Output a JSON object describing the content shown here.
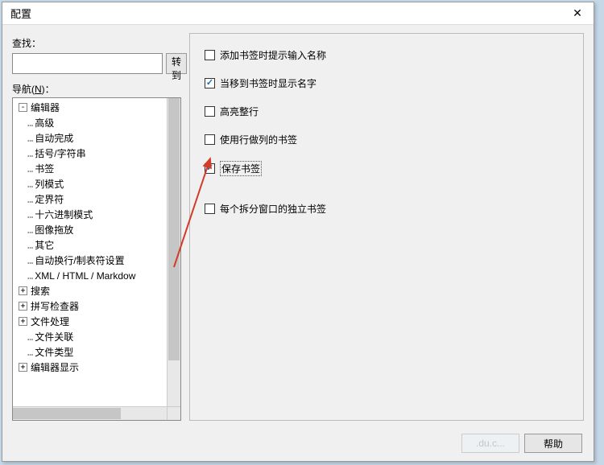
{
  "title": "配置",
  "close_glyph": "✕",
  "left": {
    "search_label": "查找：",
    "goto_btn": "转到",
    "nav_label_prefix": "导航(",
    "nav_label_key": "N",
    "nav_label_suffix": ")："
  },
  "tree": [
    {
      "depth": 0,
      "tog": "-",
      "label": "编辑器"
    },
    {
      "depth": 1,
      "tog": "",
      "label": "高级"
    },
    {
      "depth": 1,
      "tog": "",
      "label": "自动完成"
    },
    {
      "depth": 1,
      "tog": "",
      "label": "括号/字符串"
    },
    {
      "depth": 1,
      "tog": "",
      "label": "书签"
    },
    {
      "depth": 1,
      "tog": "",
      "label": "列模式"
    },
    {
      "depth": 1,
      "tog": "",
      "label": "定界符"
    },
    {
      "depth": 1,
      "tog": "",
      "label": "十六进制模式"
    },
    {
      "depth": 1,
      "tog": "",
      "label": "图像拖放"
    },
    {
      "depth": 1,
      "tog": "",
      "label": "其它"
    },
    {
      "depth": 1,
      "tog": "",
      "label": "自动换行/制表符设置"
    },
    {
      "depth": 1,
      "tog": "",
      "label": "XML / HTML / Markdow"
    },
    {
      "depth": 0,
      "tog": "+",
      "label": "搜索"
    },
    {
      "depth": 0,
      "tog": "+",
      "label": "拼写检查器"
    },
    {
      "depth": 0,
      "tog": "+",
      "label": "文件处理"
    },
    {
      "depth": 1,
      "tog": "",
      "label": "文件关联"
    },
    {
      "depth": 1,
      "tog": "",
      "label": "文件类型"
    },
    {
      "depth": 0,
      "tog": "+",
      "label": "编辑器显示"
    }
  ],
  "options": [
    {
      "label": "添加书签时提示输入名称",
      "checked": false,
      "focused": false
    },
    {
      "label": "当移到书签时显示名字",
      "checked": true,
      "focused": false
    },
    {
      "label": "高亮整行",
      "checked": false,
      "focused": false
    },
    {
      "label": "使用行做列的书签",
      "checked": false,
      "focused": false
    },
    {
      "label": "保存书签",
      "checked": true,
      "focused": true
    },
    {
      "label": "每个拆分窗口的独立书签",
      "checked": false,
      "focused": false
    }
  ],
  "footer": {
    "ghost": ".du.c...",
    "help": "帮助"
  }
}
